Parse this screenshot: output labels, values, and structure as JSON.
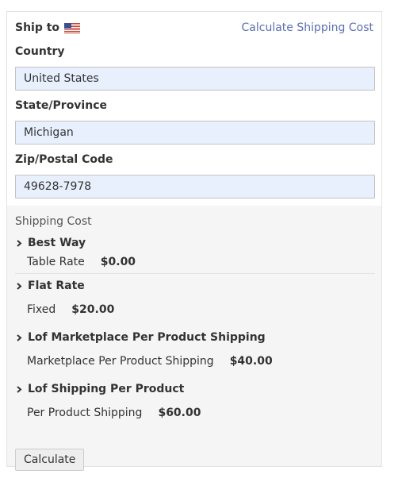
{
  "header": {
    "ship_to_label": "Ship to",
    "flag_icon": "us-flag-icon",
    "calculate_link": "Calculate Shipping Cost"
  },
  "form": {
    "country_label": "Country",
    "country_value": "United States",
    "state_label": "State/Province",
    "state_value": "Michigan",
    "zip_label": "Zip/Postal Code",
    "zip_value": "49628-7978"
  },
  "shipping": {
    "title": "Shipping Cost",
    "methods": [
      {
        "name": "Best Way",
        "rate_label": "Table Rate",
        "price": "$0.00"
      },
      {
        "name": "Flat Rate",
        "rate_label": "Fixed",
        "price": "$20.00"
      },
      {
        "name": "Lof Marketplace Per Product Shipping",
        "rate_label": "Marketplace Per Product Shipping",
        "price": "$40.00"
      },
      {
        "name": "Lof Shipping Per Product",
        "rate_label": "Per Product Shipping",
        "price": "$60.00"
      }
    ]
  },
  "actions": {
    "calculate_button": "Calculate"
  },
  "colors": {
    "link": "#5a6fb0",
    "input_bg": "#e8f0fe",
    "section_bg": "#f5f5f5"
  }
}
